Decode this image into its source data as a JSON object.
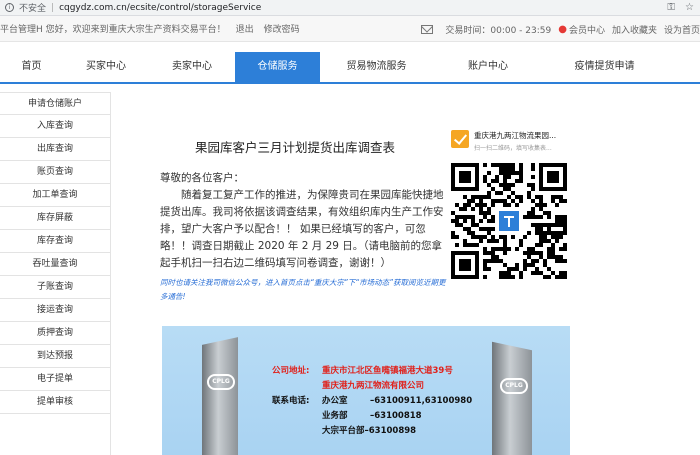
{
  "browser": {
    "security_label": "不安全",
    "url": "cqgydz.com.cn/ecsite/control/storageService"
  },
  "topstrip": {
    "greeting": "平台管理H 您好，欢迎来到重庆大宗生产资料交易平台！",
    "logout": "退出",
    "change_password": "修改密码",
    "trade_time": "交易时间：00:00 - 23:59",
    "member_center": "会员中心",
    "add_favorite": "加入收藏夹",
    "set_home": "设为首页"
  },
  "nav": {
    "items": [
      "首页",
      "买家中心",
      "卖家中心",
      "仓储服务",
      "贸易物流服务",
      "账户中心",
      "疫情提货申请"
    ],
    "active": "仓储服务"
  },
  "sidebar": {
    "items": [
      "申请仓储账户",
      "入库查询",
      "出库查询",
      "账页查询",
      "加工单查询",
      "库存屏蔽",
      "库存查询",
      "吞吐量查询",
      "子账查询",
      "接运查询",
      "质押查询",
      "到达预报",
      "电子提单",
      "提单审核"
    ]
  },
  "article": {
    "title": "果园库客户三月计划提货出库调查表",
    "salutation": "尊敬的各位客户：",
    "body": "随着复工复产工作的推进，为保障贵司在果园库能快捷地提货出库。我司将依据该调查结果，有效组织库内生产工作安排，望广大客户予以配合！！ 如果已经填写的客户，可忽略！！调查日期截止 2020 年 2 月 29 日。（请电脑前的您拿起手机扫一扫右边二维码填写问卷调查，谢谢！）",
    "note": "同时也请关注我司微信公众号，进入首页点击“重庆大宗”下“市场动态”获取阅览近期更多通告!"
  },
  "qr_card": {
    "name": "重庆港九两江物流果园...",
    "hint": "扫一扫二维码，填写收集表..."
  },
  "poster": {
    "logo_text": "CPLG",
    "address_label": "公司地址:",
    "address": "重庆市江北区鱼嘴镇福港大道39号",
    "company": "重庆港九两江物流有限公司",
    "phone_label": "联系电话:",
    "phones": [
      {
        "dept": "办公室",
        "number": "–63100911,63100980"
      },
      {
        "dept": "业务部",
        "number": "–63100818"
      },
      {
        "dept": "大宗平台部",
        "number": "–63100898"
      }
    ]
  },
  "colors": {
    "nav_active": "#2d7fd8",
    "note": "#2a6fd6",
    "poster_red": "#e0211b",
    "checkbox": "#f5a623"
  }
}
